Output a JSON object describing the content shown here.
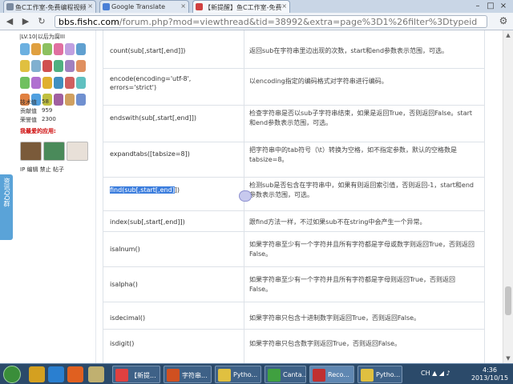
{
  "browser": {
    "tabs": [
      {
        "label": "鱼C工作室-免费编程视频",
        "active": false
      },
      {
        "label": "Google Translate",
        "active": false
      },
      {
        "label": "【新提醒】鱼C工作室-免费",
        "active": true
      }
    ],
    "url_host": "bbs.fishc.com",
    "url_rest": "/forum.php?mod=viewthread&tid=38992&extra=page%3D1%26filter%3Dtypeid"
  },
  "sidebar": {
    "level": "|LV.10|以后为腐III",
    "stats": [
      {
        "label": "技术值",
        "value": "58"
      },
      {
        "label": "贡献值",
        "value": "959"
      },
      {
        "label": "荣誉值",
        "value": "2300"
      }
    ],
    "fav_title": "我最爱的应用:",
    "links": [
      "IP",
      "编辑",
      "禁止",
      "帖子"
    ],
    "qq_label": "资讯QQ群"
  },
  "table": {
    "rows": [
      {
        "method": "count(sub[,start[,end]])",
        "desc": "返回sub在字符串里边出现的次数，start和end参数表示范围，可选。"
      },
      {
        "method": "encode(encoding='utf-8', errors='strict')",
        "desc": "以encoding指定的编码格式对字符串进行编码。"
      },
      {
        "method": "endswith(sub[,start[,end]])",
        "desc": "检查字符串是否以sub子字符串结束，如果是返回True，否则返回False。start和end参数表示范围，可选。"
      },
      {
        "method": "expandtabs([tabsize=8])",
        "desc": "把字符串中的tab符号（\\t）转换为空格，如不指定参数，默认的空格数是tabsize=8。"
      },
      {
        "method_selected": "find(sub[,start[,end]",
        "method_rest": "])",
        "desc": "检测sub是否包含在字符串中，如果有则返回索引值，否则返回-1，start和end参数表示范围，可选。"
      },
      {
        "method": "index(sub[,start[,end]])",
        "desc": "跟find方法一样，不过如果sub不在string中会产生一个异常。"
      },
      {
        "method": "isalnum()",
        "desc": "如果字符串至少有一个字符并且所有字符都是字母或数字则返回True，否则返回False。"
      },
      {
        "method": "isalpha()",
        "desc": "如果字符串至少有一个字符并且所有字符都是字母则返回True，否则返回False。"
      },
      {
        "method": "isdecimal()",
        "desc": "如果字符串只包含十进制数字则返回True，否则返回False。"
      },
      {
        "method": "isdigit()",
        "desc": "如果字符串只包含数字则返回True，否则返回False。"
      }
    ]
  },
  "taskbar": {
    "tasks": [
      "【新提...",
      "字符串...",
      "Pytho...",
      "Canta...",
      "Reco...",
      "Pytho..."
    ],
    "tray_lang": "CH",
    "time": "4:36",
    "date": "2013/10/15"
  },
  "colors": {
    "selection": "#3b7ddd",
    "taskbar": "#2b4a6a",
    "qq_bar": "#5aa3d8"
  }
}
